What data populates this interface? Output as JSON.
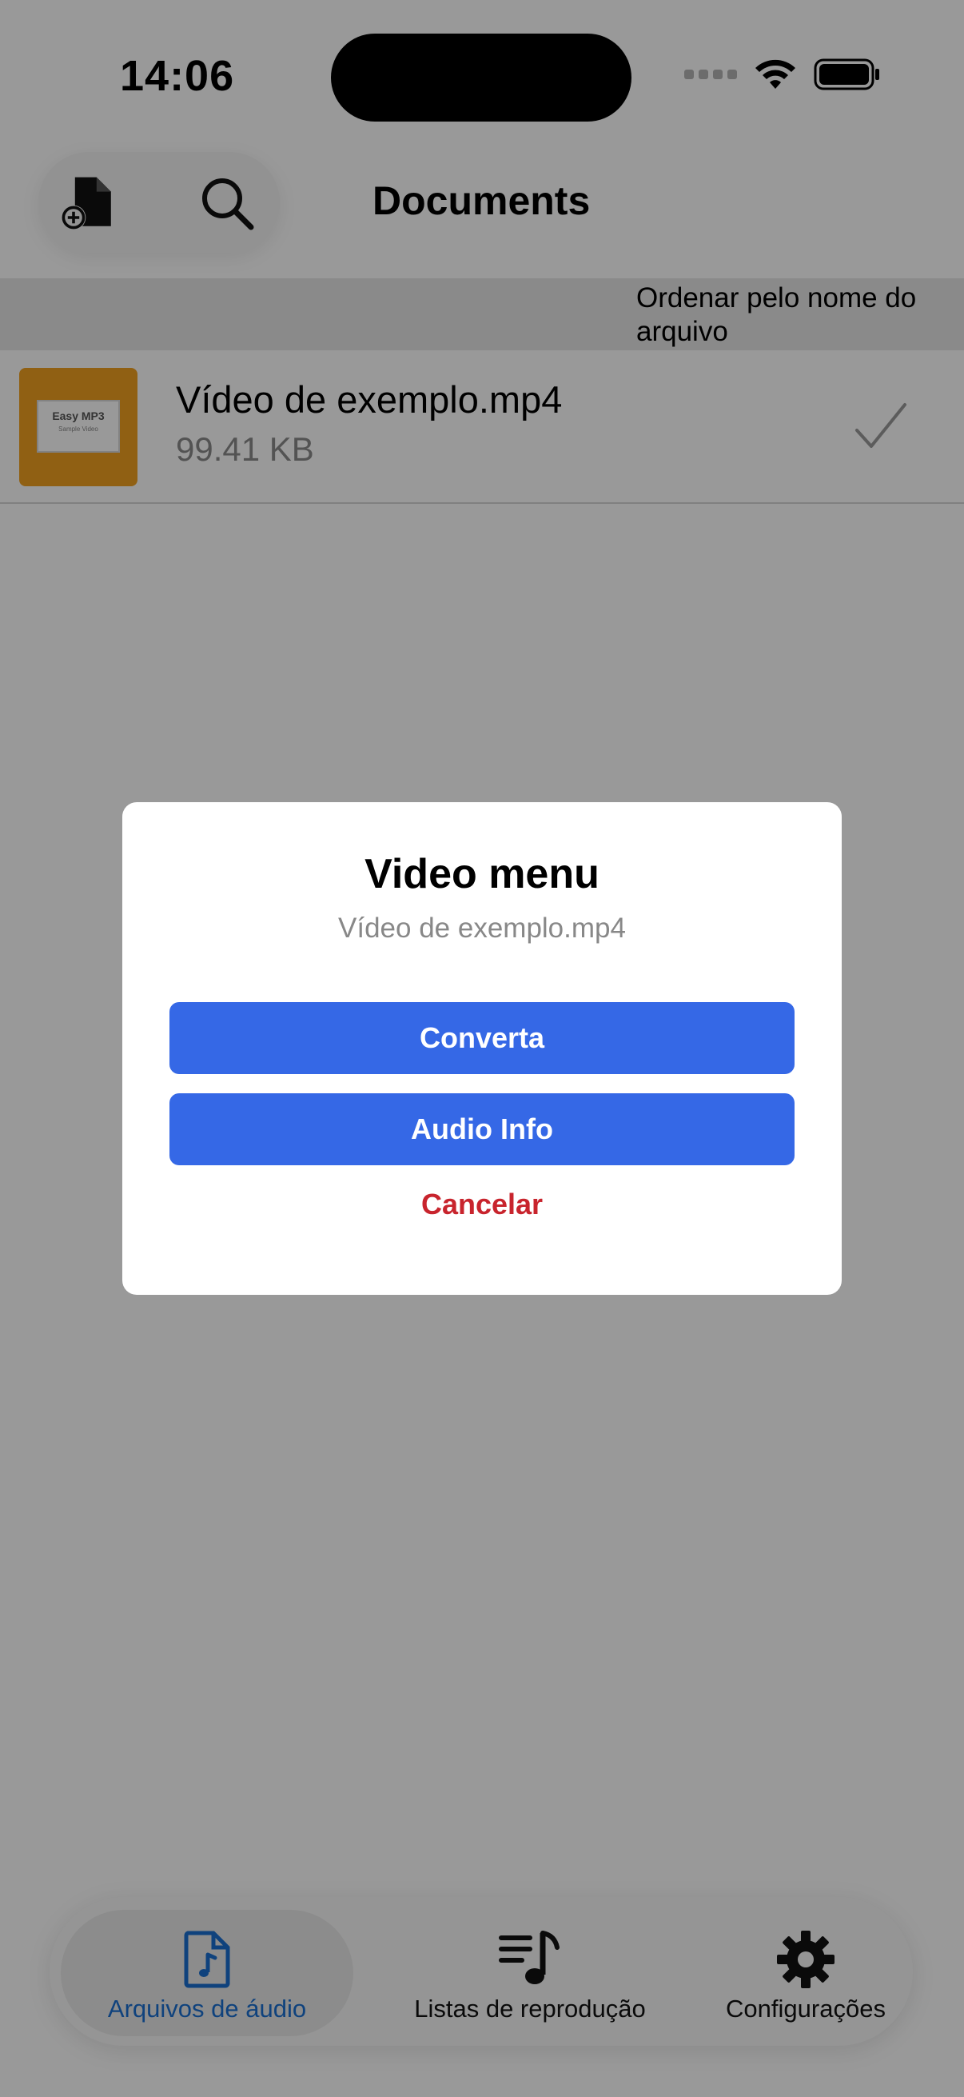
{
  "status_bar": {
    "time": "14:06"
  },
  "header": {
    "title": "Documents",
    "add_icon": "add-document-icon",
    "search_icon": "search-icon"
  },
  "sort_bar": {
    "label": "Ordenar pelo nome do arquivo"
  },
  "files": [
    {
      "name": "Vídeo de exemplo.mp4",
      "size": "99.41 KB",
      "thumbnail_title": "Easy MP3",
      "thumbnail_subtitle": "Sample Video",
      "checked": true
    }
  ],
  "dialog": {
    "title": "Video menu",
    "subtitle": "Vídeo de exemplo.mp4",
    "convert_label": "Converta",
    "audio_info_label": "Audio Info",
    "cancel_label": "Cancelar"
  },
  "tab_bar": {
    "tabs": [
      {
        "label": "Arquivos de áudio",
        "icon": "audio-file-icon",
        "active": true
      },
      {
        "label": "Listas de reprodução",
        "icon": "playlist-icon",
        "active": false
      },
      {
        "label": "Configurações",
        "icon": "gear-icon",
        "active": false
      }
    ]
  },
  "colors": {
    "accent": "#3568e6",
    "active_tab": "#1a6fd0",
    "destructive": "#c8242d",
    "thumbnail": "#f0a020"
  }
}
